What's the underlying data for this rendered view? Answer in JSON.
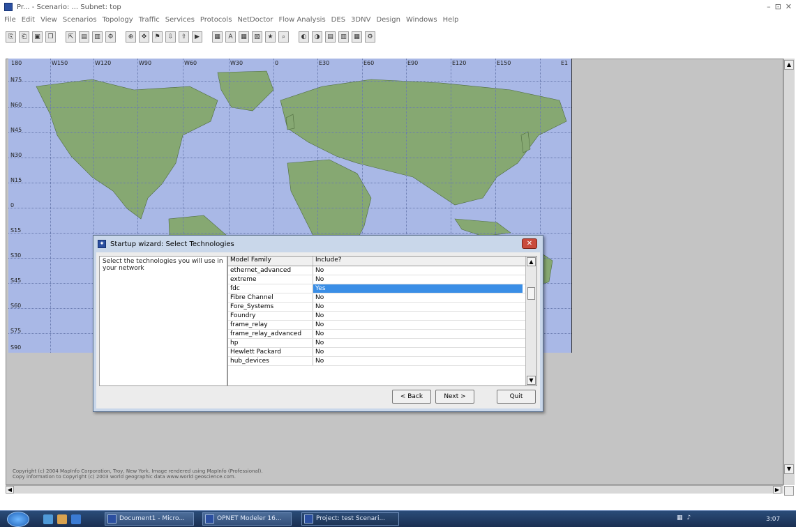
{
  "window": {
    "title": "Pr... - Scenario: ... Subnet: top",
    "controls": [
      "–",
      "⊡",
      "✕"
    ]
  },
  "menu": [
    "File",
    "Edit",
    "View",
    "Scenarios",
    "Topology",
    "Traffic",
    "Services",
    "Protocols",
    "NetDoctor",
    "Flow Analysis",
    "DES",
    "3DNV",
    "Design",
    "Windows",
    "Help"
  ],
  "toolbar_icons": [
    "new-project-icon",
    "open-icon",
    "save-icon",
    "copy-icon",
    "select-icon",
    "device-icon",
    "link-icon",
    "config-icon",
    "zoom-icon",
    "pan-icon",
    "filter-icon",
    "import-icon",
    "export-icon",
    "sim-icon",
    "results-icon",
    "text-icon",
    "grid-icon",
    "layout-icon",
    "favorite-icon",
    "inspect-icon",
    "hide-icon",
    "show-icon",
    "report-icon",
    "chart-icon",
    "table-icon",
    "settings-icon"
  ],
  "map": {
    "longitudes": [
      "180",
      "W150",
      "W120",
      "W90",
      "W60",
      "W30",
      "0",
      "E30",
      "E60",
      "E90",
      "E120",
      "E150",
      "E1"
    ],
    "latitudes": [
      "N75",
      "N60",
      "N45",
      "N30",
      "N15",
      "0",
      "S15",
      "S30",
      "S45",
      "S60",
      "S75",
      "S90"
    ]
  },
  "copyright": {
    "line1": "Copyright (c) 2004 MapInfo Corporation, Troy, New York. Image rendered using MapInfo (Professional).",
    "line2": "Copy information to Copyright (c) 2003 world geographic data www.world geoscience.com."
  },
  "dialog": {
    "title": "Startup wizard: Select Technologies",
    "description": "Select the technologies you will use in your network",
    "table_headers": {
      "family": "Model Family",
      "include": "Include?"
    },
    "rows": [
      {
        "family": "ethernet_advanced",
        "include": "No"
      },
      {
        "family": "extreme",
        "include": "No"
      },
      {
        "family": "fdc",
        "include": "Yes",
        "selected": true
      },
      {
        "family": "Fibre Channel",
        "include": "No"
      },
      {
        "family": "Fore_Systems",
        "include": "No"
      },
      {
        "family": "Foundry",
        "include": "No"
      },
      {
        "family": "frame_relay",
        "include": "No"
      },
      {
        "family": "frame_relay_advanced",
        "include": "No"
      },
      {
        "family": "hp",
        "include": "No"
      },
      {
        "family": "Hewlett Packard",
        "include": "No"
      },
      {
        "family": "hub_devices",
        "include": "No"
      }
    ],
    "buttons": {
      "back": "< Back",
      "next": "Next >",
      "quit": "Quit"
    }
  },
  "taskbar": {
    "tasks": [
      {
        "label": "Document1 - Micro..."
      },
      {
        "label": "OPNET Modeler 16..."
      },
      {
        "label": "Project: test Scenari..."
      }
    ],
    "clock": "3:07"
  }
}
